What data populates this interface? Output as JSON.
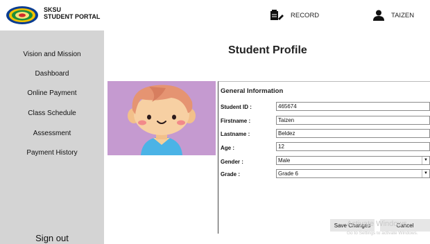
{
  "header": {
    "brand_line1": "SKSU",
    "brand_line2": "STUDENT PORTAL",
    "record_label": "RECORD",
    "user_label": "TAIZEN"
  },
  "sidebar": {
    "items": [
      {
        "label": "Vision and Mission"
      },
      {
        "label": "Dashboard"
      },
      {
        "label": "Online Payment"
      },
      {
        "label": "Class Schedule"
      },
      {
        "label": "Assessment"
      },
      {
        "label": "Payment History"
      }
    ],
    "signout_label": "Sign out"
  },
  "main": {
    "title": "Student Profile",
    "form": {
      "heading": "General Information",
      "student_id_label": "Student ID :",
      "student_id": "465674",
      "firstname_label": "Firstname :",
      "firstname": "Taizen",
      "lastname_label": "Lastname :",
      "lastname": "Beldez",
      "age_label": "Age :",
      "age": "12",
      "gender_label": "Gender :",
      "gender": "Male",
      "grade_label": "Grade :",
      "grade": "Grade 6"
    },
    "save_label": "Save Changes",
    "cancel_label": "Cancel"
  },
  "watermark": {
    "line1": "Activate Windows",
    "line2": "Go to Settings to activate Windows."
  },
  "colors": {
    "sidebar_bg": "#d4d4d4",
    "avatar_bg": "#c59ad0",
    "button_bg": "#e6e6e6"
  }
}
